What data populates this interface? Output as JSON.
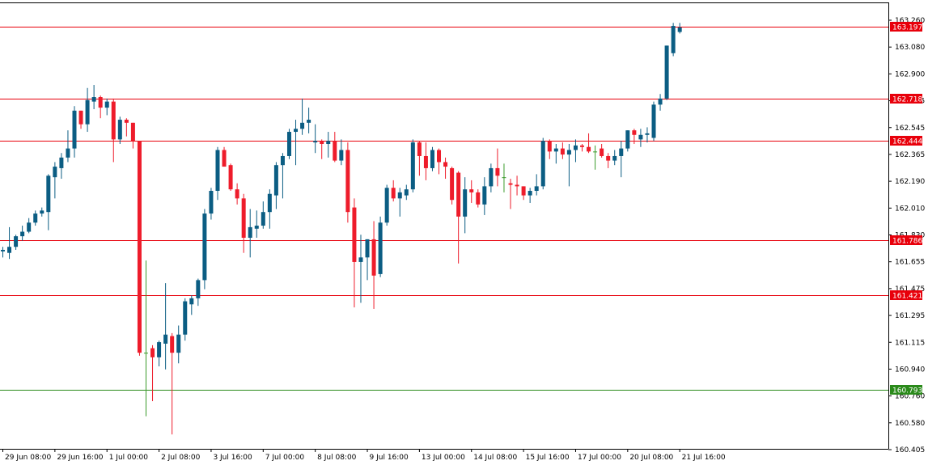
{
  "chart_data": {
    "type": "candlestick",
    "ylim": [
      160.405,
      163.35
    ],
    "y_ticks": [
      "163.260",
      "163.080",
      "162.900",
      "162.725",
      "162.545",
      "162.365",
      "162.190",
      "162.010",
      "161.830",
      "161.655",
      "161.475",
      "161.295",
      "161.115",
      "160.940",
      "160.760",
      "160.580",
      "160.405"
    ],
    "x_labels": [
      {
        "label": "29 Jun 08:00",
        "index": 0
      },
      {
        "label": "29 Jun 16:00",
        "index": 8
      },
      {
        "label": "1 Jul 00:00",
        "index": 16
      },
      {
        "label": "2 Jul 08:00",
        "index": 24
      },
      {
        "label": "3 Jul 16:00",
        "index": 32
      },
      {
        "label": "7 Jul 00:00",
        "index": 40
      },
      {
        "label": "8 Jul 08:00",
        "index": 48
      },
      {
        "label": "9 Jul 16:00",
        "index": 56
      },
      {
        "label": "13 Jul 00:00",
        "index": 64
      },
      {
        "label": "14 Jul 08:00",
        "index": 72
      },
      {
        "label": "15 Jul 16:00",
        "index": 80
      },
      {
        "label": "17 Jul 00:00",
        "index": 88
      },
      {
        "label": "20 Jul 08:00",
        "index": 96
      },
      {
        "label": "21 Jul 16:00",
        "index": 104
      }
    ],
    "candles": [
      {
        "o": 161.71,
        "h": 161.74,
        "l": 161.67,
        "c": 161.72
      },
      {
        "o": 161.7,
        "h": 161.87,
        "l": 161.66,
        "c": 161.74
      },
      {
        "o": 161.74,
        "h": 161.82,
        "l": 161.72,
        "c": 161.81
      },
      {
        "o": 161.81,
        "h": 161.88,
        "l": 161.78,
        "c": 161.84
      },
      {
        "o": 161.84,
        "h": 161.93,
        "l": 161.83,
        "c": 161.9
      },
      {
        "o": 161.9,
        "h": 161.98,
        "l": 161.88,
        "c": 161.96
      },
      {
        "o": 161.96,
        "h": 162.0,
        "l": 161.94,
        "c": 161.98
      },
      {
        "o": 161.97,
        "h": 162.22,
        "l": 161.85,
        "c": 162.21
      },
      {
        "o": 162.2,
        "h": 162.3,
        "l": 162.06,
        "c": 162.27
      },
      {
        "o": 162.26,
        "h": 162.36,
        "l": 162.19,
        "c": 162.33
      },
      {
        "o": 162.33,
        "h": 162.51,
        "l": 162.3,
        "c": 162.39
      },
      {
        "o": 162.39,
        "h": 162.67,
        "l": 162.33,
        "c": 162.64
      },
      {
        "o": 162.64,
        "h": 162.64,
        "l": 162.52,
        "c": 162.55
      },
      {
        "o": 162.55,
        "h": 162.79,
        "l": 162.5,
        "c": 162.71
      },
      {
        "o": 162.7,
        "h": 162.81,
        "l": 162.65,
        "c": 162.73
      },
      {
        "o": 162.73,
        "h": 162.74,
        "l": 162.59,
        "c": 162.66
      },
      {
        "o": 162.66,
        "h": 162.72,
        "l": 162.61,
        "c": 162.7
      },
      {
        "o": 162.7,
        "h": 162.72,
        "l": 162.3,
        "c": 162.45
      },
      {
        "o": 162.45,
        "h": 162.6,
        "l": 162.42,
        "c": 162.58
      },
      {
        "o": 162.58,
        "h": 162.59,
        "l": 162.47,
        "c": 162.56
      },
      {
        "o": 162.56,
        "h": 162.56,
        "l": 162.39,
        "c": 162.44
      },
      {
        "o": 162.44,
        "h": 162.44,
        "l": 161.02,
        "c": 161.04
      },
      {
        "o": 161.04,
        "h": 161.65,
        "l": 160.62,
        "c": 161.04
      },
      {
        "o": 161.07,
        "h": 161.09,
        "l": 160.72,
        "c": 161.01
      },
      {
        "o": 161.01,
        "h": 161.12,
        "l": 160.95,
        "c": 161.11
      },
      {
        "o": 161.1,
        "h": 161.5,
        "l": 160.93,
        "c": 161.16
      },
      {
        "o": 161.15,
        "h": 161.17,
        "l": 160.5,
        "c": 161.04
      },
      {
        "o": 161.04,
        "h": 161.22,
        "l": 160.97,
        "c": 161.16
      },
      {
        "o": 161.16,
        "h": 161.4,
        "l": 161.12,
        "c": 161.38
      },
      {
        "o": 161.36,
        "h": 161.42,
        "l": 161.29,
        "c": 161.4
      },
      {
        "o": 161.4,
        "h": 161.53,
        "l": 161.35,
        "c": 161.52
      },
      {
        "o": 161.52,
        "h": 161.99,
        "l": 161.46,
        "c": 161.96
      },
      {
        "o": 161.96,
        "h": 162.13,
        "l": 161.92,
        "c": 162.11
      },
      {
        "o": 162.11,
        "h": 162.4,
        "l": 162.05,
        "c": 162.38
      },
      {
        "o": 162.38,
        "h": 162.4,
        "l": 162.27,
        "c": 162.27
      },
      {
        "o": 162.28,
        "h": 162.29,
        "l": 162.11,
        "c": 162.12
      },
      {
        "o": 162.12,
        "h": 162.16,
        "l": 162.02,
        "c": 162.06
      },
      {
        "o": 162.06,
        "h": 162.09,
        "l": 161.7,
        "c": 161.8
      },
      {
        "o": 161.8,
        "h": 161.99,
        "l": 161.67,
        "c": 161.87
      },
      {
        "o": 161.86,
        "h": 161.98,
        "l": 161.8,
        "c": 161.88
      },
      {
        "o": 161.88,
        "h": 162.04,
        "l": 161.86,
        "c": 161.97
      },
      {
        "o": 161.97,
        "h": 162.12,
        "l": 161.86,
        "c": 162.09
      },
      {
        "o": 162.08,
        "h": 162.3,
        "l": 161.99,
        "c": 162.28
      },
      {
        "o": 162.28,
        "h": 162.36,
        "l": 162.06,
        "c": 162.34
      },
      {
        "o": 162.34,
        "h": 162.52,
        "l": 162.32,
        "c": 162.5
      },
      {
        "o": 162.5,
        "h": 162.58,
        "l": 162.28,
        "c": 162.52
      },
      {
        "o": 162.52,
        "h": 162.72,
        "l": 162.48,
        "c": 162.56
      },
      {
        "o": 162.56,
        "h": 162.66,
        "l": 162.49,
        "c": 162.58
      },
      {
        "o": 162.43,
        "h": 162.55,
        "l": 162.36,
        "c": 162.44
      },
      {
        "o": 162.44,
        "h": 162.45,
        "l": 162.32,
        "c": 162.42
      },
      {
        "o": 162.42,
        "h": 162.5,
        "l": 162.33,
        "c": 162.44
      },
      {
        "o": 162.44,
        "h": 162.5,
        "l": 162.3,
        "c": 162.31
      },
      {
        "o": 162.31,
        "h": 162.45,
        "l": 162.28,
        "c": 162.38
      },
      {
        "o": 162.38,
        "h": 162.43,
        "l": 161.9,
        "c": 161.97
      },
      {
        "o": 162.0,
        "h": 162.06,
        "l": 161.34,
        "c": 161.64
      },
      {
        "o": 161.64,
        "h": 161.82,
        "l": 161.37,
        "c": 161.67
      },
      {
        "o": 161.67,
        "h": 161.79,
        "l": 161.52,
        "c": 161.79
      },
      {
        "o": 161.79,
        "h": 161.91,
        "l": 161.33,
        "c": 161.55
      },
      {
        "o": 161.56,
        "h": 161.94,
        "l": 161.54,
        "c": 161.9
      },
      {
        "o": 161.9,
        "h": 162.15,
        "l": 161.88,
        "c": 162.13
      },
      {
        "o": 162.13,
        "h": 162.18,
        "l": 162.04,
        "c": 162.06
      },
      {
        "o": 162.06,
        "h": 162.13,
        "l": 161.94,
        "c": 162.1
      },
      {
        "o": 162.08,
        "h": 162.15,
        "l": 162.05,
        "c": 162.12
      },
      {
        "o": 162.12,
        "h": 162.45,
        "l": 162.1,
        "c": 162.43
      },
      {
        "o": 162.43,
        "h": 162.44,
        "l": 162.21,
        "c": 162.34
      },
      {
        "o": 162.34,
        "h": 162.43,
        "l": 162.18,
        "c": 162.26
      },
      {
        "o": 162.26,
        "h": 162.4,
        "l": 162.24,
        "c": 162.38
      },
      {
        "o": 162.38,
        "h": 162.39,
        "l": 162.22,
        "c": 162.3
      },
      {
        "o": 162.3,
        "h": 162.33,
        "l": 162.19,
        "c": 162.27
      },
      {
        "o": 162.26,
        "h": 162.27,
        "l": 162.02,
        "c": 162.05
      },
      {
        "o": 162.23,
        "h": 162.24,
        "l": 161.63,
        "c": 161.94
      },
      {
        "o": 161.94,
        "h": 162.2,
        "l": 161.83,
        "c": 162.12
      },
      {
        "o": 162.12,
        "h": 162.18,
        "l": 162.03,
        "c": 162.1
      },
      {
        "o": 162.1,
        "h": 162.12,
        "l": 162.0,
        "c": 162.02
      },
      {
        "o": 162.02,
        "h": 162.2,
        "l": 161.95,
        "c": 162.14
      },
      {
        "o": 162.14,
        "h": 162.29,
        "l": 162.1,
        "c": 162.26
      },
      {
        "o": 162.26,
        "h": 162.39,
        "l": 162.14,
        "c": 162.21
      },
      {
        "o": 162.2,
        "h": 162.29,
        "l": 162.1,
        "c": 162.2
      },
      {
        "o": 162.16,
        "h": 162.19,
        "l": 161.99,
        "c": 162.15
      },
      {
        "o": 162.15,
        "h": 162.21,
        "l": 162.08,
        "c": 162.14
      },
      {
        "o": 162.14,
        "h": 162.14,
        "l": 162.05,
        "c": 162.08
      },
      {
        "o": 162.08,
        "h": 162.13,
        "l": 162.03,
        "c": 162.11
      },
      {
        "o": 162.11,
        "h": 162.22,
        "l": 162.08,
        "c": 162.14
      },
      {
        "o": 162.14,
        "h": 162.46,
        "l": 162.12,
        "c": 162.44
      },
      {
        "o": 162.44,
        "h": 162.45,
        "l": 162.32,
        "c": 162.37
      },
      {
        "o": 162.37,
        "h": 162.42,
        "l": 162.29,
        "c": 162.39
      },
      {
        "o": 162.39,
        "h": 162.43,
        "l": 162.32,
        "c": 162.35
      },
      {
        "o": 162.35,
        "h": 162.42,
        "l": 162.14,
        "c": 162.38
      },
      {
        "o": 162.38,
        "h": 162.45,
        "l": 162.3,
        "c": 162.41
      },
      {
        "o": 162.41,
        "h": 162.42,
        "l": 162.37,
        "c": 162.4
      },
      {
        "o": 162.4,
        "h": 162.49,
        "l": 162.36,
        "c": 162.37
      },
      {
        "o": 162.37,
        "h": 162.41,
        "l": 162.25,
        "c": 162.37
      },
      {
        "o": 162.39,
        "h": 162.42,
        "l": 162.33,
        "c": 162.34
      },
      {
        "o": 162.34,
        "h": 162.36,
        "l": 162.26,
        "c": 162.31
      },
      {
        "o": 162.31,
        "h": 162.38,
        "l": 162.28,
        "c": 162.34
      },
      {
        "o": 162.34,
        "h": 162.44,
        "l": 162.2,
        "c": 162.39
      },
      {
        "o": 162.39,
        "h": 162.51,
        "l": 162.37,
        "c": 162.51
      },
      {
        "o": 162.51,
        "h": 162.52,
        "l": 162.42,
        "c": 162.48
      },
      {
        "o": 162.45,
        "h": 162.52,
        "l": 162.4,
        "c": 162.48
      },
      {
        "o": 162.48,
        "h": 162.53,
        "l": 162.43,
        "c": 162.49
      },
      {
        "o": 162.46,
        "h": 162.7,
        "l": 162.44,
        "c": 162.68
      },
      {
        "o": 162.68,
        "h": 162.75,
        "l": 162.64,
        "c": 162.72
      },
      {
        "o": 162.72,
        "h": 163.07,
        "l": 162.71,
        "c": 163.07
      },
      {
        "o": 163.02,
        "h": 163.22,
        "l": 163.0,
        "c": 163.2
      },
      {
        "o": 163.16,
        "h": 163.22,
        "l": 163.15,
        "c": 163.19
      }
    ],
    "levels": [
      {
        "value": 163.197,
        "label": "163.197",
        "color": "#e8000b"
      },
      {
        "value": 162.718,
        "label": "162.718",
        "color": "#e8000b"
      },
      {
        "value": 162.444,
        "label": "162.444",
        "color": "#e8000b"
      },
      {
        "value": 161.786,
        "label": "161.786",
        "color": "#e8000b"
      },
      {
        "value": 161.421,
        "label": "161.421",
        "color": "#e8000b"
      },
      {
        "value": 160.793,
        "label": "160.793",
        "color": "#2a8a1a"
      }
    ],
    "colors": {
      "bull": "#0b5d83",
      "bear": "#ee1c2b",
      "doji": "#3a9a2a",
      "axis": "#000000",
      "background": "#ffffff"
    },
    "grid": false
  }
}
